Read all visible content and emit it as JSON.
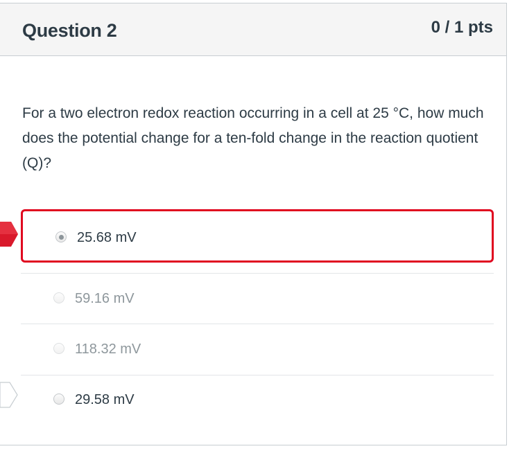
{
  "question": {
    "title": "Question 2",
    "points": "0 / 1 pts",
    "text": "For a two electron redox reaction occurring in a cell at 25 °C, how much does the potential change for a ten-fold change in the reaction quotient (Q)?"
  },
  "answers": [
    {
      "label": "25.68 mV",
      "state": "selected-incorrect"
    },
    {
      "label": "59.16 mV",
      "state": "unselected"
    },
    {
      "label": "118.32 mV",
      "state": "unselected"
    },
    {
      "label": "29.58 mV",
      "state": "correct-answer"
    }
  ],
  "colors": {
    "incorrect_flag": "#e0061f",
    "selected_border": "#e0061f",
    "text": "#2d3b45",
    "faded_text": "#8e979c",
    "header_bg": "#f5f5f5"
  },
  "icons": {
    "incorrect_flag": "you-answered-flag-icon",
    "correct_flag": "correct-answer-flag-icon"
  }
}
